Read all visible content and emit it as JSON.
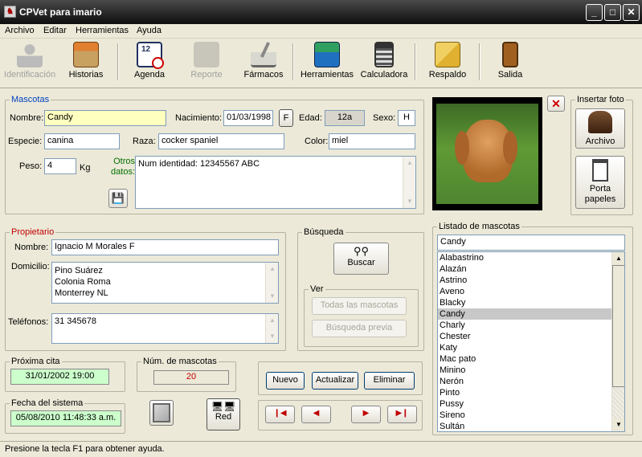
{
  "window": {
    "title": "CPVet para imario",
    "icon": "app-icon",
    "controls": [
      "minimize",
      "maximize",
      "close"
    ]
  },
  "menu": [
    "Archivo",
    "Editar",
    "Herramientas",
    "Ayuda"
  ],
  "toolbar": [
    {
      "label": "Identificación",
      "icon": "person-icon",
      "enabled": false
    },
    {
      "label": "Historias",
      "icon": "file-box-icon",
      "enabled": true
    },
    {
      "label": "Agenda",
      "icon": "calendar-clock-icon",
      "enabled": true
    },
    {
      "label": "Reporte",
      "icon": "clipboard-icon",
      "enabled": false
    },
    {
      "label": "Fármacos",
      "icon": "mortar-pestle-icon",
      "enabled": true
    },
    {
      "label": "Herramientas",
      "icon": "toolbox-icon",
      "enabled": true
    },
    {
      "label": "Calculadora",
      "icon": "calculator-icon",
      "enabled": true
    },
    {
      "label": "Respaldo",
      "icon": "folder-backup-icon",
      "enabled": true
    },
    {
      "label": "Salida",
      "icon": "exit-door-icon",
      "enabled": true
    }
  ],
  "mascotas": {
    "group_label": "Mascotas",
    "nombre_label": "Nombre:",
    "nombre": "Candy",
    "nacimiento_label": "Nacimiento:",
    "nacimiento": "01/03/1998",
    "sexo_btn": "F",
    "edad_label": "Edad:",
    "edad": "12a",
    "sexo_label": "Sexo:",
    "sexo": "H",
    "especie_label": "Especie:",
    "especie": "canina",
    "raza_label": "Raza:",
    "raza": "cocker spaniel",
    "color_label": "Color:",
    "color": "miel",
    "peso_label": "Peso:",
    "peso": "4",
    "peso_unit": "Kg",
    "otros_label": "Otros datos:",
    "otros": "Num identidad: 12345567 ABC"
  },
  "foto": {
    "insert_label": "Insertar foto",
    "archivo_btn": "Archivo",
    "porta_btn": "Porta papeles"
  },
  "propietario": {
    "group_label": "Propietario",
    "nombre_label": "Nombre:",
    "nombre": "Ignacio M Morales F",
    "domicilio_label": "Domicilio:",
    "domicilio": [
      "Pino Suárez",
      "Colonia Roma",
      "Monterrey NL"
    ],
    "telefonos_label": "Teléfonos:",
    "telefonos": "31 345678"
  },
  "busqueda": {
    "group_label": "Búsqueda",
    "buscar_btn": "Buscar",
    "ver_label": "Ver",
    "todas_btn": "Todas las mascotas",
    "previa_btn": "Búsqueda previa"
  },
  "listado": {
    "group_label": "Listado de mascotas",
    "search": "Candy",
    "selected": "Candy",
    "items": [
      "Alabastrino",
      "Alazán",
      "Astrino",
      "Aveno",
      "Blacky",
      "Candy",
      "Charly",
      "Chester",
      "Katy",
      "Mac pato",
      "Minino",
      "Nerón",
      "Pinto",
      "Pussy",
      "Sireno",
      "Sultán"
    ]
  },
  "proxima_cita": {
    "label": "Próxima cita",
    "value": "31/01/2002 19:00"
  },
  "num_mascotas": {
    "label": "Núm. de mascotas",
    "value": "20"
  },
  "fecha_sistema": {
    "label": "Fecha del sistema",
    "value": "05/08/2010 11:48:33 a.m."
  },
  "red_btn": "Red",
  "actions": {
    "nuevo": "Nuevo",
    "actualizar": "Actualizar",
    "eliminar": "Eliminar"
  },
  "nav": {
    "first": "first-record-icon",
    "prev": "prev-record-icon",
    "next": "next-record-icon",
    "last": "last-record-icon"
  },
  "status": "Presione la tecla F1 para obtener ayuda.",
  "colors": {
    "title_bar": "#1a1a1a",
    "cita_bg": "#ccffcc",
    "yellow_field": "#ffffc0",
    "num_red": "#c00000",
    "label_blue": "#0040c0"
  }
}
